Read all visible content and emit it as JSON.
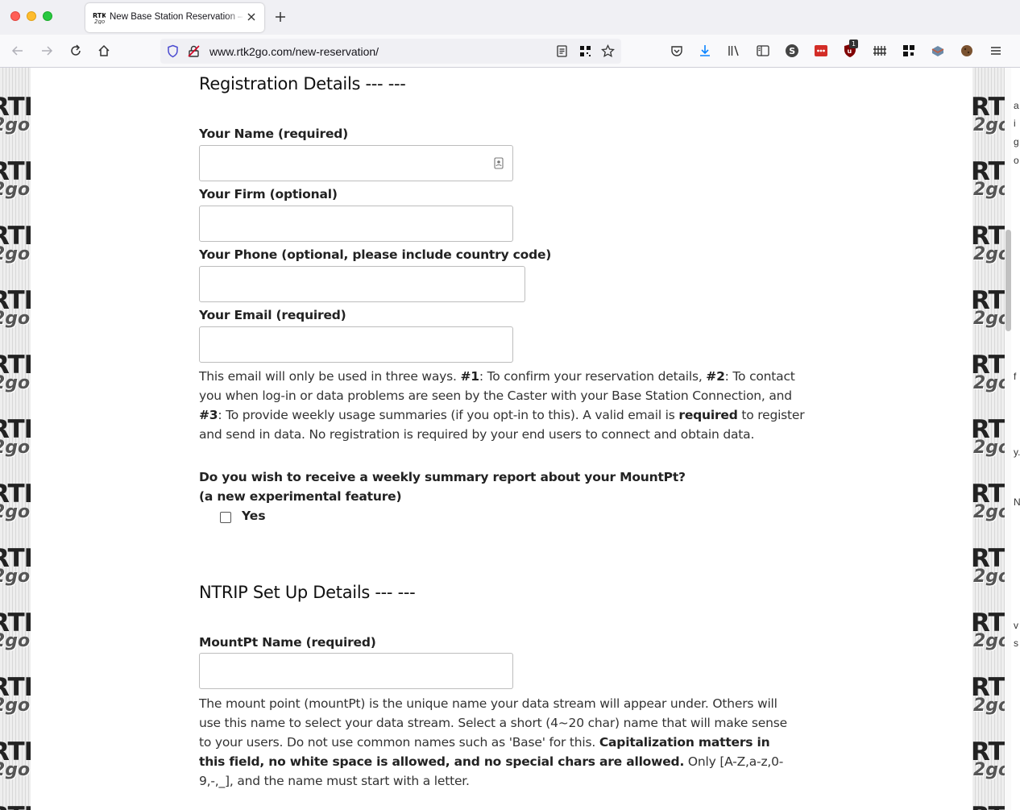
{
  "browser": {
    "tab_title": "New Base Station Reservation – RTK2go",
    "url": "www.rtk2go.com/new-reservation/",
    "extension_badge": "1"
  },
  "icons": {
    "back": "back-arrow-icon",
    "forward": "forward-arrow-icon",
    "reload": "reload-icon",
    "home": "home-icon",
    "shield": "tracking-protection-shield-icon",
    "insecure": "insecure-lock-icon",
    "reader": "reader-view-icon",
    "qr": "qr-code-icon",
    "bookmark": "bookmark-star-icon",
    "pocket": "pocket-icon",
    "downloads": "download-icon",
    "library": "library-icon",
    "sidebar": "sidebar-icon",
    "menu": "hamburger-menu-icon"
  },
  "background": {
    "watermark_top": "RTK",
    "watermark_bottom": "2go",
    "edge_fragments": [
      "a",
      "i",
      "g",
      "o",
      "f",
      "y.",
      "N",
      "v",
      "s"
    ]
  },
  "registration": {
    "heading": "Registration Details --- ---",
    "name_label": "Your Name (required)",
    "name_value": "",
    "firm_label": "Your Firm (optional)",
    "firm_value": "",
    "phone_label": "Your Phone (optional, please include country code)",
    "phone_value": "",
    "email_label": "Your Email (required)",
    "email_value": "",
    "email_note": {
      "t1": "This email will only be used in three ways. ",
      "b1": "#1",
      "t2": ": To confirm your reservation details, ",
      "b2": "#2",
      "t3": ": To contact you when log-in or data problems are seen by the Caster with your Base Station Connection, and ",
      "b3": "#3",
      "t4": ": To provide weekly usage summaries (if you opt-in to this). A valid email is ",
      "b4": "required",
      "t5": " to register and send in data. No registration is required by your end users to connect and obtain data."
    },
    "weekly_question": "Do you wish to receive a weekly summary report about your MountPt?",
    "weekly_sub": "(a new experimental feature)",
    "weekly_option": "Yes",
    "weekly_checked": false
  },
  "ntrip": {
    "heading": "NTRIP Set Up Details --- ---",
    "mountpt_label": "MountPt Name (required)",
    "mountpt_value": "",
    "mountpt_note": {
      "t1": "The mount point (mountPt) is the unique name your data stream will appear under. Others will use this name to select your data stream. Select a short (4~20 char) name that will make sense to your users. Do not use common names such as 'Base' for this. ",
      "b1": "Capitalization matters in this field, no white space is allowed, and no special chars are allowed.",
      "t2": " Only [A-Z,a-z,0-9,-,_], and the name must start with a letter."
    }
  }
}
